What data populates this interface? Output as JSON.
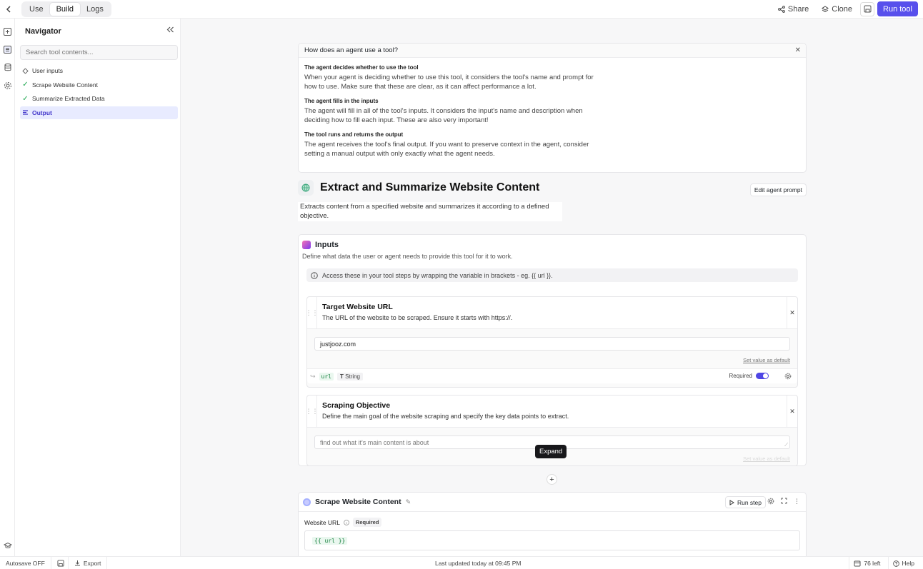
{
  "topbar": {
    "modes": [
      "Use",
      "Build",
      "Logs"
    ],
    "active_mode": "Build",
    "share_label": "Share",
    "clone_label": "Clone",
    "run_tool_label": "Run tool"
  },
  "navigator": {
    "title": "Navigator",
    "search_placeholder": "Search tool contents...",
    "items": [
      {
        "label": "User inputs",
        "icon": "input-icon"
      },
      {
        "label": "Scrape Website Content",
        "icon": "check-icon"
      },
      {
        "label": "Summarize Extracted Data",
        "icon": "check-icon"
      },
      {
        "label": "Output",
        "icon": "output-icon"
      }
    ]
  },
  "help": {
    "title": "How does an agent use a tool?",
    "sections": [
      {
        "heading": "The agent decides whether to use the tool",
        "text": "When your agent is deciding whether to use this tool, it considers the tool's name and prompt for how to use. Make sure that these are clear, as it can affect performance a lot."
      },
      {
        "heading": "The agent fills in the inputs",
        "text": "The agent will fill in all of the tool's inputs. It considers the input's name and description when deciding how to fill each input. These are also very important!"
      },
      {
        "heading": "The tool runs and returns the output",
        "text": "The agent receives the tool's final output. If you want to preserve context in the agent, consider setting a manual output with only exactly what the agent needs."
      }
    ]
  },
  "tool": {
    "title": "Extract and Summarize Website Content",
    "description": "Extracts content from a specified website and summarizes it according to a defined objective.",
    "edit_prompt_label": "Edit agent prompt"
  },
  "inputs": {
    "title": "Inputs",
    "subtitle": "Define what data the user or agent needs to provide this tool for it to work.",
    "info": "Access these in your tool steps by wrapping the variable in brackets - eg. {{ url }}.",
    "fields": [
      {
        "name": "Target Website URL",
        "description": "The URL of the website to be scraped. Ensure it starts with https://.",
        "value": "justjooz.com",
        "set_default_label": "Set value as default",
        "variable": "url",
        "type": "String",
        "required_label": "Required"
      },
      {
        "name": "Scraping Objective",
        "description": "Define the main goal of the website scraping and specify the key data points to extract.",
        "placeholder": "find out what it's main content is about",
        "set_default_label": "Set value as default"
      }
    ],
    "tooltip": "Expand"
  },
  "step": {
    "name": "Scrape Website Content",
    "run_step_label": "Run step",
    "field_label": "Website URL",
    "required_badge": "Required",
    "value": "{{ url }}"
  },
  "bottombar": {
    "autosave": "Autosave OFF",
    "export": "Export",
    "updated": "Last updated today at 09:45 PM",
    "left_count": "76 left",
    "help": "Help"
  },
  "colors": {
    "accent": "#5850ec",
    "check": "#16a34a",
    "code_bg": "#eaf7ef"
  }
}
